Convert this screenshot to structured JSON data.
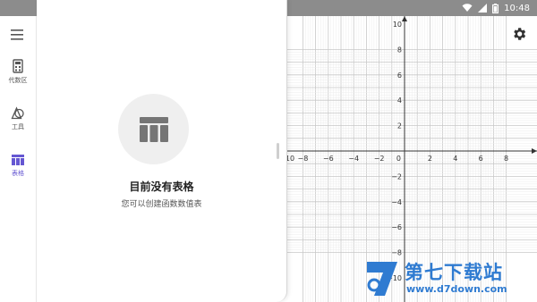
{
  "status_bar": {
    "time": "10:48",
    "icons": [
      "wifi-icon",
      "signal-icon",
      "battery-icon"
    ]
  },
  "rail": {
    "items": [
      {
        "label": "代数区",
        "icon": "calculator-icon"
      },
      {
        "label": "工具",
        "icon": "tools-icon"
      },
      {
        "label": "表格",
        "icon": "table-icon",
        "active": true
      }
    ]
  },
  "panel": {
    "empty_title": "目前没有表格",
    "empty_subtitle": "您可以创建函数数值表",
    "empty_icon": "table-icon"
  },
  "graph": {
    "x_ticks": [
      "10",
      "−8",
      "−6",
      "−4",
      "−2",
      "0",
      "2",
      "4",
      "6",
      "8"
    ],
    "y_ticks": [
      "10",
      "8",
      "6",
      "4",
      "2",
      "−2",
      "−4",
      "−6",
      "−8",
      "−10"
    ],
    "settings_icon": "gear-icon"
  },
  "watermark": {
    "title": "第七下载站",
    "url": "www.d7down.com"
  },
  "colors": {
    "accent": "#6557d2",
    "status_bar": "#8c8c8c",
    "grid_minor": "#ececec",
    "grid_major": "#c8c8c8",
    "watermark": "#2f7bd1"
  }
}
